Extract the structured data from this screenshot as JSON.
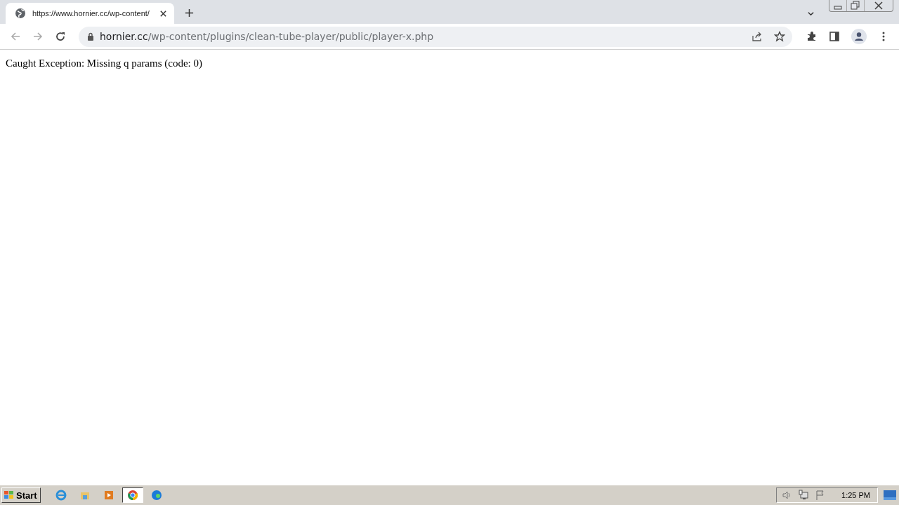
{
  "tab": {
    "title": "https://www.hornier.cc/wp-content/"
  },
  "address_bar": {
    "host": "hornier.cc",
    "path": "/wp-content/plugins/clean-tube-player/public/player-x.php"
  },
  "page": {
    "message": "Caught Exception: Missing q params (code: 0)"
  },
  "taskbar": {
    "start_label": "Start",
    "apps": [
      {
        "kind": "ie",
        "selected": false
      },
      {
        "kind": "folder",
        "selected": false
      },
      {
        "kind": "media",
        "selected": false
      },
      {
        "kind": "chrome",
        "selected": true
      },
      {
        "kind": "edge",
        "selected": false
      }
    ],
    "clock": "1:25 PM"
  }
}
